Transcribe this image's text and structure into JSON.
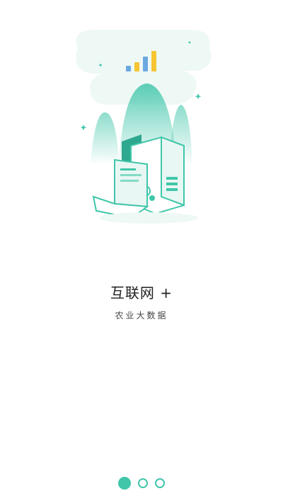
{
  "onboarding": {
    "title": "互联网 +",
    "subtitle": "农业大数据",
    "page_count": 3,
    "active_page": 1
  },
  "illustration": {
    "name": "server-laptop-illustration",
    "icons": [
      "bar-chart-icon",
      "server-icon",
      "laptop-icon",
      "sparkle-icon"
    ]
  },
  "colors": {
    "accent": "#41c6aa",
    "accent_light": "#e8f7f3",
    "chart_blue": "#6aa8e0",
    "chart_yellow": "#f5c532",
    "text_primary": "#222222",
    "text_secondary": "#444444"
  }
}
